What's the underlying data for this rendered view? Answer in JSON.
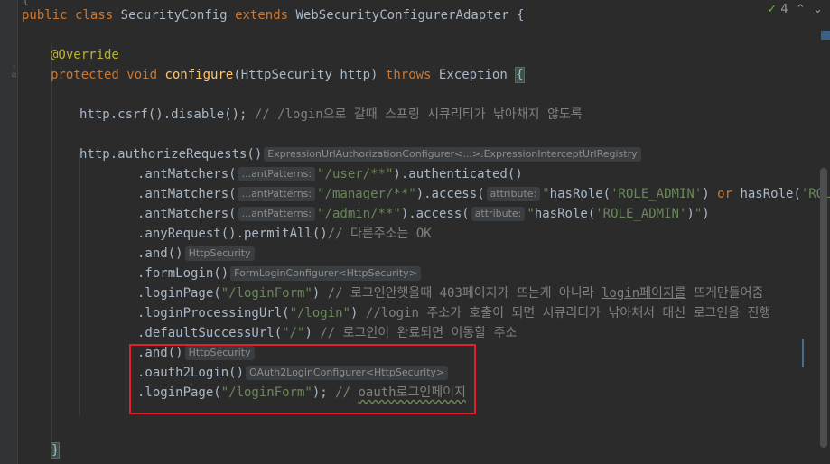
{
  "editor": {
    "status": {
      "check": "✓",
      "count": "4",
      "up": "⌃",
      "down": "⌄"
    },
    "lines": {
      "l1_kw1": "public",
      "l1_kw2": "class",
      "l1_name": "SecurityConfig",
      "l1_kw3": "extends",
      "l1_super": "WebSecurityConfigurerAdapter",
      "l1_brace": "{",
      "l2_override": "@Override",
      "l3_kw1": "protected",
      "l3_kw2": "void",
      "l3_fn": "configure",
      "l3_params": "(HttpSecurity http)",
      "l3_kw3": "throws",
      "l3_ex": "Exception",
      "l3_brace": "{",
      "l4_code": "http.csrf().disable();",
      "l4_comment": "// /login으로 갈때 스프링 시큐리티가 낚아채지 않도록",
      "l5_code": "http.authorizeRequests()",
      "l5_hint": "ExpressionUrlAuthorizationConfigurer<...>.ExpressionInterceptUrlRegistry",
      "l6_pre": ".antMatchers(",
      "l6_hint": "...antPatterns:",
      "l6_str": "\"/user/**\"",
      "l6_post": ").authenticated()",
      "l7_pre": ".antMatchers(",
      "l7_hint": "...antPatterns:",
      "l7_str": "\"/manager/**\"",
      "l7_mid": ").access(",
      "l7_hint2": "attribute:",
      "l7_str2a": "\"",
      "l7_s1": "hasRole(",
      "l7_s2": "'ROLE_ADMIN'",
      "l7_s3": ")",
      "l7_or": "or",
      "l7_s4": "hasRole(",
      "l7_s5": "'ROLE_M",
      "l8_pre": ".antMatchers(",
      "l8_hint": "...antPatterns:",
      "l8_str": "\"/admin/**\"",
      "l8_mid": ").access(",
      "l8_hint2": "attribute:",
      "l8_str2a": "\"",
      "l8_s1": "hasRole(",
      "l8_s2": "'ROLE_ADMIN'",
      "l8_s3": ")",
      "l8_str2b": "\"",
      "l8_post": ")",
      "l9_code": ".anyRequest().permitAll()",
      "l9_comment": "// 다른주소는 OK",
      "l10_code": ".and()",
      "l10_hint": "HttpSecurity",
      "l11_code": ".formLogin()",
      "l11_hint": "FormLoginConfigurer<HttpSecurity>",
      "l12_pre": ".loginPage(",
      "l12_str": "\"/loginForm\"",
      "l12_post": ")",
      "l12_comment": "// 로그인안햇을때 403페이지가 뜨는게 아니라 ",
      "l12_comment_u": "login페이지를",
      "l12_comment_end": " 뜨게만들어줌",
      "l13_pre": ".loginProcessingUrl(",
      "l13_str": "\"/login\"",
      "l13_post": ")",
      "l13_comment": "//login 주소가 호출이 되면 시큐리티가 낚아채서 대신 로그인을 진행",
      "l14_pre": ".defaultSuccessUrl(",
      "l14_str": "\"/\"",
      "l14_post": ")",
      "l14_comment": "// 로그인이 완료되면 이동할 주소",
      "l15_code": ".and()",
      "l15_hint": "HttpSecurity",
      "l16_code": ".oauth2Login()",
      "l16_hint": "OAuth2LoginConfigurer<HttpSecurity>",
      "l17_pre": ".loginPage(",
      "l17_str": "\"/loginForm\"",
      "l17_post": ");",
      "l17_comment": "// ",
      "l17_comment_u": "oauth로그인페이지",
      "l18_brace": "}"
    }
  }
}
